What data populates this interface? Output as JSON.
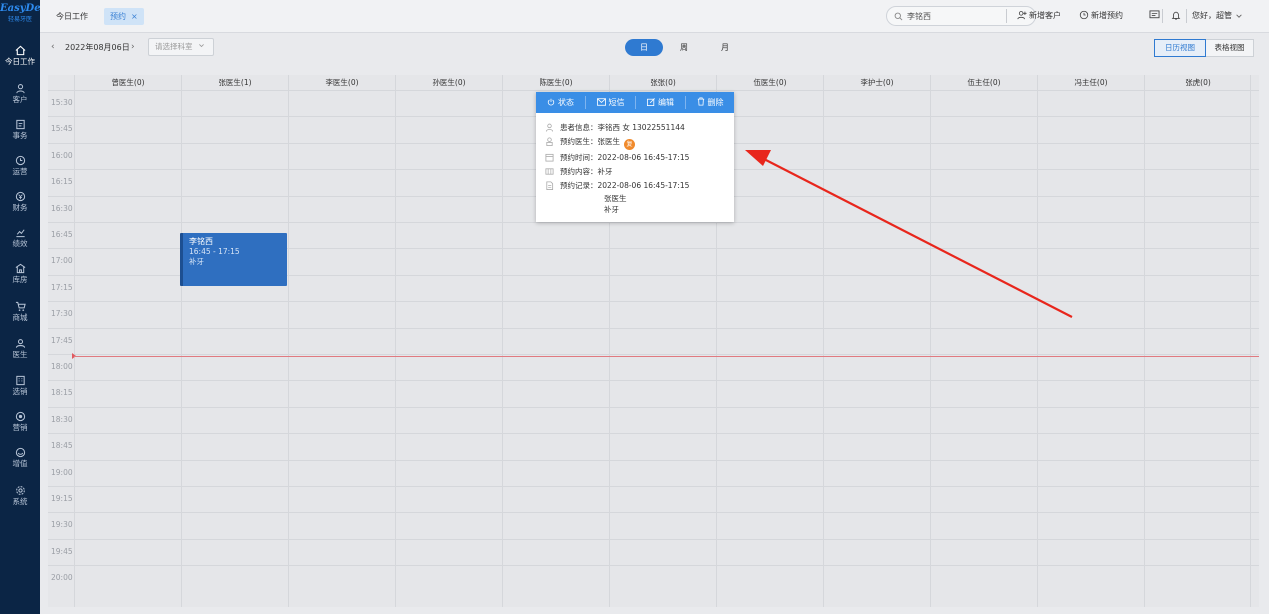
{
  "app": {
    "logo_text": "EasyDent",
    "logo_sub": "轻易牙医"
  },
  "sidebar": {
    "items": [
      {
        "label": "今日工作",
        "icon": "home-icon"
      },
      {
        "label": "客户",
        "icon": "user-icon"
      },
      {
        "label": "事务",
        "icon": "task-icon"
      },
      {
        "label": "运营",
        "icon": "clock-icon"
      },
      {
        "label": "财务",
        "icon": "finance-icon"
      },
      {
        "label": "绩效",
        "icon": "chart-icon"
      },
      {
        "label": "库房",
        "icon": "warehouse-icon"
      },
      {
        "label": "商城",
        "icon": "cart-icon"
      },
      {
        "label": "医生",
        "icon": "doctor-icon"
      },
      {
        "label": "选销",
        "icon": "building-icon"
      },
      {
        "label": "营销",
        "icon": "marketing-icon"
      },
      {
        "label": "增值",
        "icon": "value-icon"
      },
      {
        "label": "系统",
        "icon": "gear-icon"
      }
    ]
  },
  "topbar": {
    "tabs": [
      {
        "label": "今日工作"
      },
      {
        "label": "预约",
        "close": "×"
      }
    ],
    "search_value": "李铭西",
    "new_customer": "新增客户",
    "new_appointment": "新增预约",
    "greeting": "您好，超管"
  },
  "toolbar": {
    "prev": "‹",
    "date": "2022年08月06日",
    "next": "›",
    "dept_placeholder": "请选择科室",
    "seg": {
      "day": "日",
      "week": "周",
      "month": "月"
    },
    "view_calendar": "日历视图",
    "view_table": "表格视图"
  },
  "calendar": {
    "doctors": [
      "曾医生(0)",
      "张医生(1)",
      "李医生(0)",
      "孙医生(0)",
      "陈医生(0)",
      "张张(0)",
      "伍医生(0)",
      "李护士(0)",
      "伍主任(0)",
      "冯主任(0)",
      "张虎(0)"
    ],
    "times": [
      "15:30",
      "15:45",
      "16:00",
      "16:15",
      "16:30",
      "16:45",
      "17:00",
      "17:15",
      "17:30",
      "17:45",
      "18:00",
      "18:15",
      "18:30",
      "18:45",
      "19:00",
      "19:15",
      "19:30",
      "19:45",
      "20:00"
    ],
    "appointment": {
      "name": "李铭西",
      "time": "16:45 - 17:15",
      "content": "补牙"
    }
  },
  "popup": {
    "actions": {
      "status": "状态",
      "sms": "短信",
      "edit": "编辑",
      "delete": "删除"
    },
    "patient_label": "患者信息：",
    "patient_value": "李铭西  女  13022551144",
    "doctor_label": "预约医生：",
    "doctor_value": "张医生",
    "doctor_badge": "复",
    "time_label": "预约时间：",
    "time_value": "2022-08-06 16:45-17:15",
    "content_label": "预约内容：",
    "content_value": "补牙",
    "record_label": "预约记录：",
    "record_line1": "2022-08-06 16:45-17:15",
    "record_line2": "张医生",
    "record_line3": "补牙"
  },
  "colors": {
    "sidebar": "#0b2545",
    "accent": "#2f7ad1",
    "popup_bar": "#3a8ee6",
    "arrow": "#e8261c",
    "now_line": "#e07a80"
  }
}
